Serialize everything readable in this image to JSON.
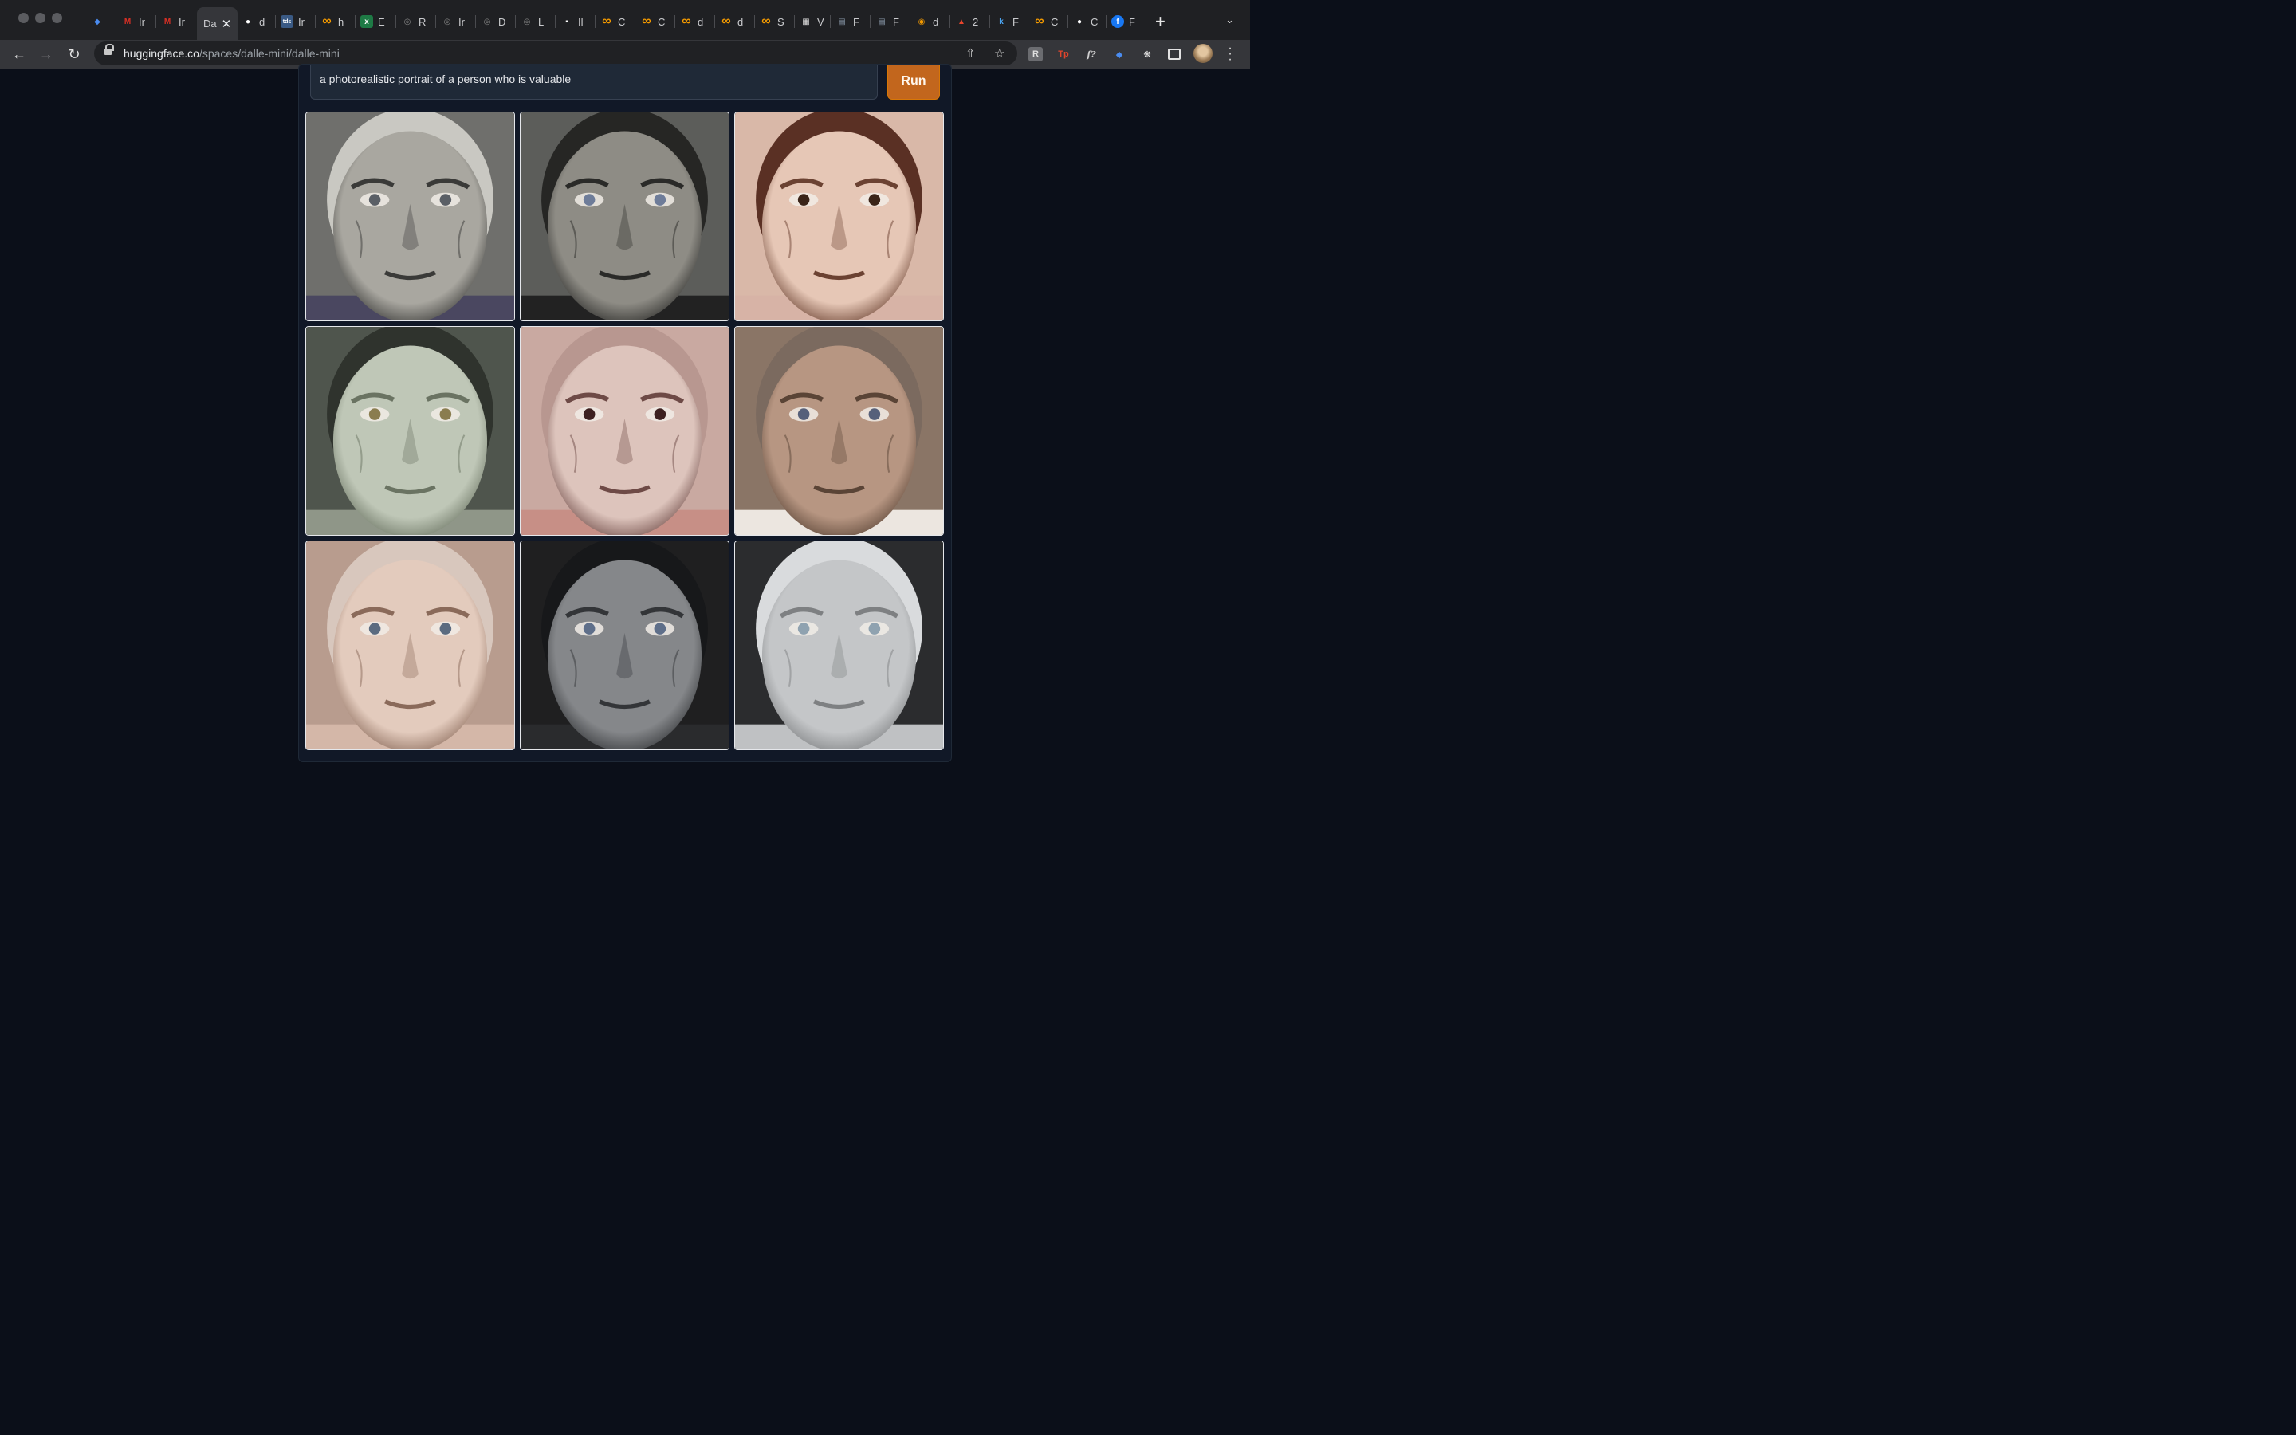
{
  "window": {
    "traffic_lights": [
      "close",
      "minimize",
      "zoom"
    ]
  },
  "tabs": [
    {
      "icon": "gem-icon",
      "label": "",
      "color": "#4a8cf0"
    },
    {
      "icon": "gmail-icon",
      "label": "Ir",
      "color": "#d93025"
    },
    {
      "icon": "gmail-icon",
      "label": "Ir",
      "color": "#d93025"
    },
    {
      "icon": "none",
      "label": "Da",
      "active": true
    },
    {
      "icon": "github-icon",
      "label": "d",
      "color": "#ffffff"
    },
    {
      "icon": "tds-icon",
      "label": "Ir",
      "color": "#3a5a85"
    },
    {
      "icon": "colab-icon",
      "label": "h",
      "color": "#f29900"
    },
    {
      "icon": "excel-icon",
      "label": "E",
      "color": "#1e7a45"
    },
    {
      "icon": "globe-icon",
      "label": "R",
      "color": "#888888"
    },
    {
      "icon": "globe-icon",
      "label": "Ir",
      "color": "#888888"
    },
    {
      "icon": "globe-icon",
      "label": "D",
      "color": "#888888"
    },
    {
      "icon": "globe-icon",
      "label": "L",
      "color": "#888888"
    },
    {
      "icon": "notion-icon",
      "label": "Il",
      "color": "#ffffff"
    },
    {
      "icon": "colab-icon",
      "label": "C",
      "color": "#f29900"
    },
    {
      "icon": "colab-icon",
      "label": "C",
      "color": "#f29900"
    },
    {
      "icon": "colab-icon",
      "label": "d",
      "color": "#f29900"
    },
    {
      "icon": "colab-icon",
      "label": "d",
      "color": "#f29900"
    },
    {
      "icon": "colab-icon",
      "label": "S",
      "color": "#f29900"
    },
    {
      "icon": "qr-icon",
      "label": "V",
      "color": "#dddddd"
    },
    {
      "icon": "book-icon",
      "label": "F",
      "color": "#8899aa"
    },
    {
      "icon": "book-icon",
      "label": "F",
      "color": "#8899aa"
    },
    {
      "icon": "chrome-icon",
      "label": "d",
      "color": "#f29900"
    },
    {
      "icon": "flame-icon",
      "label": "2",
      "color": "#e8452c"
    },
    {
      "icon": "k-icon",
      "label": "F",
      "color": "#4aa3f0"
    },
    {
      "icon": "colab-icon",
      "label": "C",
      "color": "#f29900"
    },
    {
      "icon": "github-icon",
      "label": "C",
      "color": "#ffffff"
    },
    {
      "icon": "facebook-icon",
      "label": "F",
      "color": "#1877f2"
    }
  ],
  "toolbar": {
    "url_host": "huggingface.co",
    "url_path": "/spaces/dalle-mini/dalle-mini"
  },
  "app": {
    "prompt_value": "a photorealistic portrait  of a person who is valuable",
    "run_label": "Run",
    "accent_color": "#c2661d",
    "results": [
      {
        "label": "elderly man, patterned shirt, grey tones"
      },
      {
        "label": "woman with dark bob hair, grey tones"
      },
      {
        "label": "close-up face, brown eyes, warm skin"
      },
      {
        "label": "pale greenish face, dark hair strands"
      },
      {
        "label": "pale face, red nose and lips"
      },
      {
        "label": "wrinkled face, blue eyes, split tone"
      },
      {
        "label": "woman, blue eyes, warm skin"
      },
      {
        "label": "woman in black beanie, grey tones"
      },
      {
        "label": "white sculpted face, light eyes"
      }
    ]
  }
}
